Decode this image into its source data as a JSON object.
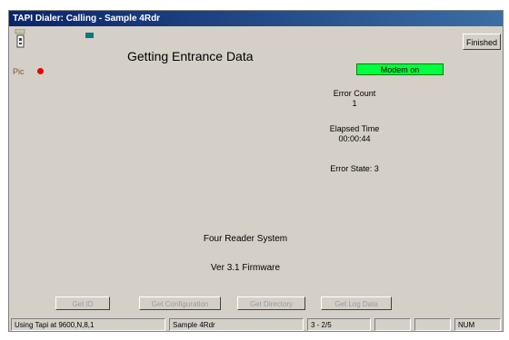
{
  "window": {
    "title": "TAPI Dialer: Calling - Sample 4Rdr"
  },
  "header": {
    "title": "Getting Entrance Data",
    "pic_label": "Pic",
    "finished_label": "Finished",
    "modem_status": "Modem on",
    "colors": {
      "modem": "#00ff40",
      "indicator": "#e00000",
      "titlebar": "#0a246a"
    }
  },
  "stats": {
    "error_count_label": "Error Count",
    "error_count_value": "1",
    "elapsed_label": "Elapsed Time",
    "elapsed_value": "00:00:44",
    "error_state": "Error State: 3"
  },
  "info": {
    "system": "Four Reader System",
    "firmware": "Ver 3.1 Firmware"
  },
  "buttons": [
    "Get ID",
    "Get Configuration",
    "Get Directory",
    "Get Log Data"
  ],
  "statusbar": {
    "connection": "Using Tapi at 9600,N,8,1",
    "site": "Sample 4Rdr",
    "progress": "3 - 2/5",
    "pane4": "",
    "pane5": "",
    "num": "NUM"
  }
}
